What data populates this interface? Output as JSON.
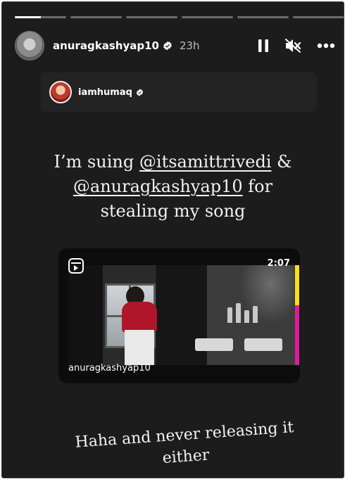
{
  "progress": {
    "segments": 6,
    "active_index": 0,
    "active_fraction": 0.5
  },
  "header": {
    "username": "anuragkashyap10",
    "time": "23h",
    "icons": [
      "pause-icon",
      "muted-icon",
      "more-icon"
    ]
  },
  "repost": {
    "username": "iamhumaq"
  },
  "caption": {
    "line1_prefix": "I’m suing ",
    "mention1": "@itsamittrivedi",
    "line1_suffix": " &",
    "mention2": "@anuragkashyap10",
    "line2_suffix": " for",
    "line3": "stealing my song"
  },
  "video": {
    "duration": "2:07",
    "username": "anuragkashyap10",
    "accent_colors": [
      "#f7e11a",
      "#e01aa0"
    ]
  },
  "caption2": {
    "line1": "Haha and never releasing it",
    "line2": "either"
  },
  "colors": {
    "background": "#1c1c1c",
    "text": "#f2f2f2",
    "verified": "#ffffff"
  }
}
